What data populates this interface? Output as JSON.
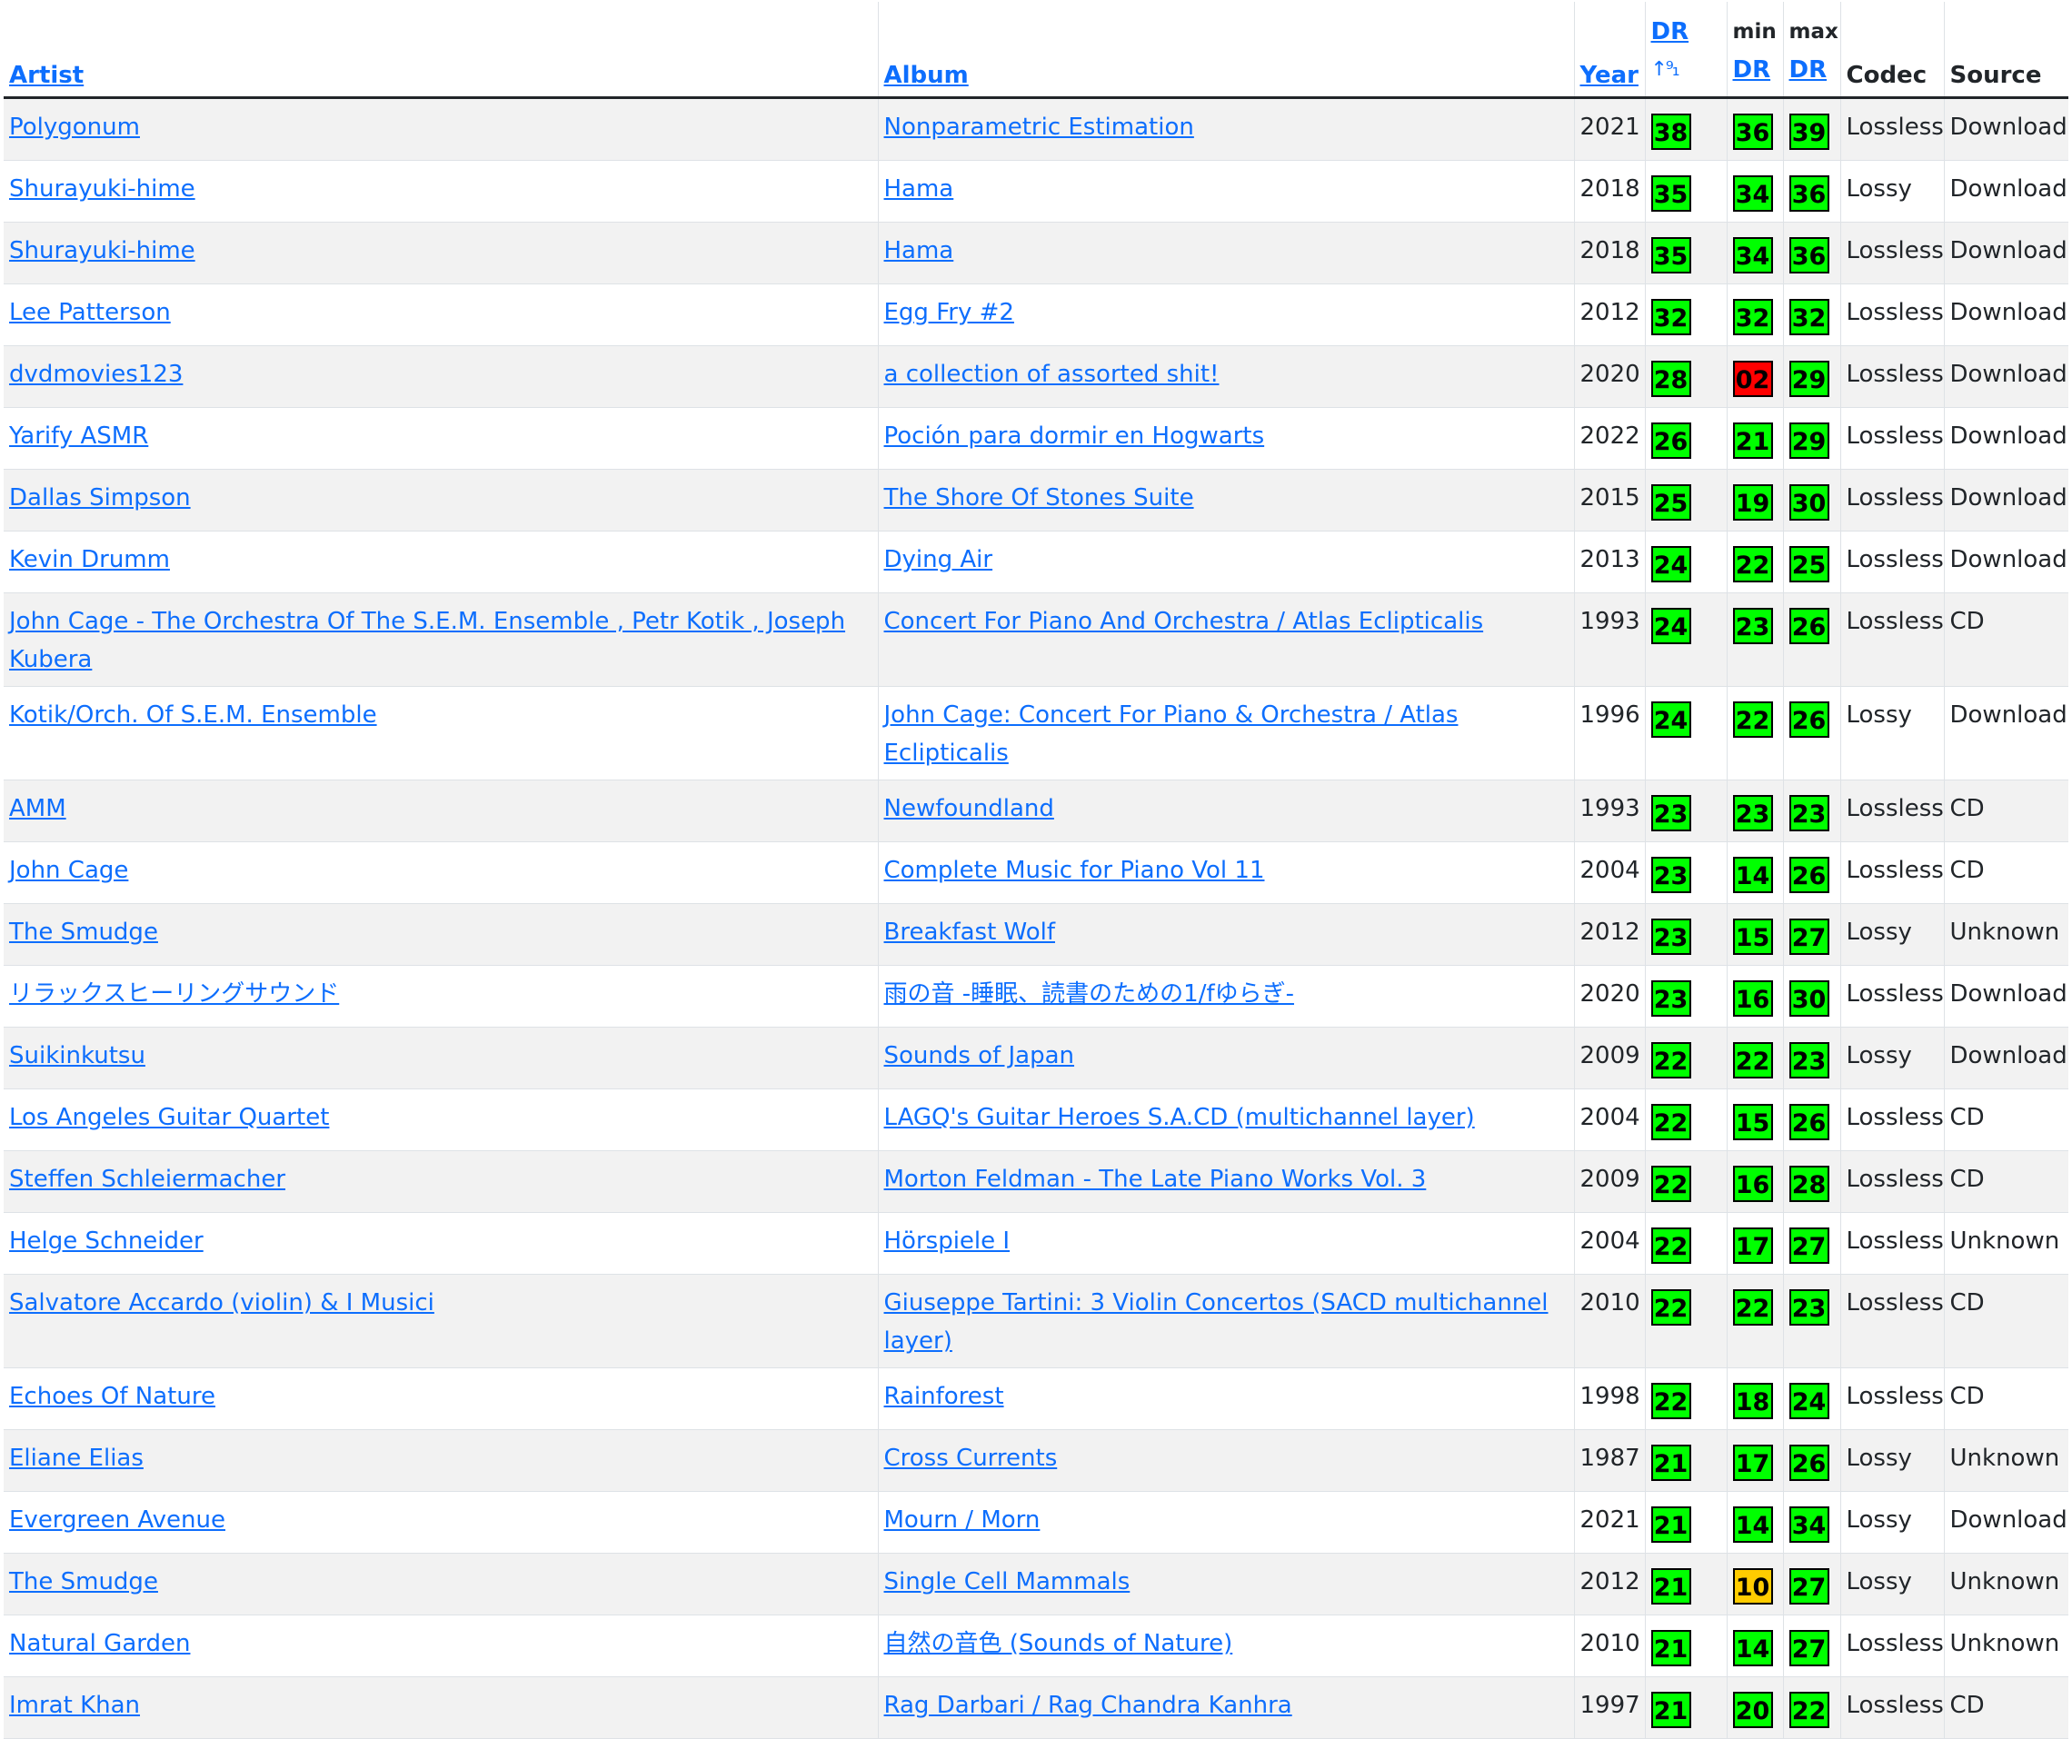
{
  "headers": {
    "artist": "Artist",
    "album": "Album",
    "year": "Year",
    "dr": "DR",
    "dr_sort_icon": "↑⁹₁",
    "min_label": "min",
    "min_dr": "DR",
    "max_label": "max",
    "max_dr": "DR",
    "codec": "Codec",
    "source": "Source"
  },
  "colors": {
    "link": "#0d6efd",
    "dr_good": "#00ff00",
    "dr_warn": "#ffcc00",
    "dr_bad": "#ff0000"
  },
  "rows": [
    {
      "artist": "Polygonum",
      "album": "Nonparametric Estimation",
      "year": "2021",
      "dr": "38",
      "min": "36",
      "max": "39",
      "codec": "Lossless",
      "source": "Download",
      "min_color": "green"
    },
    {
      "artist": "Shurayuki-hime",
      "album": "Hama",
      "year": "2018",
      "dr": "35",
      "min": "34",
      "max": "36",
      "codec": "Lossy",
      "source": "Download",
      "min_color": "green"
    },
    {
      "artist": "Shurayuki-hime",
      "album": "Hama",
      "year": "2018",
      "dr": "35",
      "min": "34",
      "max": "36",
      "codec": "Lossless",
      "source": "Download",
      "min_color": "green"
    },
    {
      "artist": "Lee Patterson",
      "album": "Egg Fry #2",
      "year": "2012",
      "dr": "32",
      "min": "32",
      "max": "32",
      "codec": "Lossless",
      "source": "Download",
      "min_color": "green"
    },
    {
      "artist": "dvdmovies123",
      "album": "a collection of assorted shit!",
      "year": "2020",
      "dr": "28",
      "min": "02",
      "max": "29",
      "codec": "Lossless",
      "source": "Download",
      "min_color": "red"
    },
    {
      "artist": "Yarify ASMR",
      "album": "Poción para dormir en Hogwarts",
      "year": "2022",
      "dr": "26",
      "min": "21",
      "max": "29",
      "codec": "Lossless",
      "source": "Download",
      "min_color": "green"
    },
    {
      "artist": "Dallas Simpson",
      "album": "The Shore Of Stones Suite",
      "year": "2015",
      "dr": "25",
      "min": "19",
      "max": "30",
      "codec": "Lossless",
      "source": "Download",
      "min_color": "green"
    },
    {
      "artist": "Kevin Drumm",
      "album": "Dying Air",
      "year": "2013",
      "dr": "24",
      "min": "22",
      "max": "25",
      "codec": "Lossless",
      "source": "Download",
      "min_color": "green"
    },
    {
      "artist": "John Cage - The Orchestra Of The S.E.M. Ensemble , Petr Kotik , Joseph Kubera",
      "album": "Concert For Piano And Orchestra / Atlas Eclipticalis",
      "year": "1993",
      "dr": "24",
      "min": "23",
      "max": "26",
      "codec": "Lossless",
      "source": "CD",
      "min_color": "green"
    },
    {
      "artist": "Kotik/Orch. Of S.E.M. Ensemble",
      "album": "John Cage: Concert For Piano & Orchestra / Atlas Eclipticalis",
      "year": "1996",
      "dr": "24",
      "min": "22",
      "max": "26",
      "codec": "Lossy",
      "source": "Download",
      "min_color": "green"
    },
    {
      "artist": "AMM",
      "album": "Newfoundland",
      "year": "1993",
      "dr": "23",
      "min": "23",
      "max": "23",
      "codec": "Lossless",
      "source": "CD",
      "min_color": "green"
    },
    {
      "artist": "John Cage",
      "album": "Complete Music for Piano Vol 11",
      "year": "2004",
      "dr": "23",
      "min": "14",
      "max": "26",
      "codec": "Lossless",
      "source": "CD",
      "min_color": "green"
    },
    {
      "artist": "The Smudge",
      "album": "Breakfast Wolf",
      "year": "2012",
      "dr": "23",
      "min": "15",
      "max": "27",
      "codec": "Lossy",
      "source": "Unknown",
      "min_color": "green"
    },
    {
      "artist": "リラックスヒーリングサウンド",
      "album": "雨の音 -睡眠、読書のための1/fゆらぎ-",
      "year": "2020",
      "dr": "23",
      "min": "16",
      "max": "30",
      "codec": "Lossless",
      "source": "Download",
      "min_color": "green"
    },
    {
      "artist": "Suikinkutsu",
      "album": "Sounds of Japan",
      "year": "2009",
      "dr": "22",
      "min": "22",
      "max": "23",
      "codec": "Lossy",
      "source": "Download",
      "min_color": "green"
    },
    {
      "artist": "Los Angeles Guitar Quartet",
      "album": "LAGQ's Guitar Heroes S.A.CD (multichannel layer)",
      "year": "2004",
      "dr": "22",
      "min": "15",
      "max": "26",
      "codec": "Lossless",
      "source": "CD",
      "min_color": "green"
    },
    {
      "artist": "Steffen Schleiermacher",
      "album": "Morton Feldman - The Late Piano Works Vol. 3",
      "year": "2009",
      "dr": "22",
      "min": "16",
      "max": "28",
      "codec": "Lossless",
      "source": "CD",
      "min_color": "green"
    },
    {
      "artist": "Helge Schneider",
      "album": "Hörspiele I",
      "year": "2004",
      "dr": "22",
      "min": "17",
      "max": "27",
      "codec": "Lossless",
      "source": "Unknown",
      "min_color": "green"
    },
    {
      "artist": "Salvatore Accardo (violin) & I Musici",
      "album": "Giuseppe Tartini: 3 Violin Concertos (SACD multichannel layer)",
      "year": "2010",
      "dr": "22",
      "min": "22",
      "max": "23",
      "codec": "Lossless",
      "source": "CD",
      "min_color": "green"
    },
    {
      "artist": "Echoes Of Nature",
      "album": "Rainforest",
      "year": "1998",
      "dr": "22",
      "min": "18",
      "max": "24",
      "codec": "Lossless",
      "source": "CD",
      "min_color": "green"
    },
    {
      "artist": "Eliane Elias",
      "album": "Cross Currents",
      "year": "1987",
      "dr": "21",
      "min": "17",
      "max": "26",
      "codec": "Lossy",
      "source": "Unknown",
      "min_color": "green"
    },
    {
      "artist": "Evergreen Avenue",
      "album": "Mourn / Morn",
      "year": "2021",
      "dr": "21",
      "min": "14",
      "max": "34",
      "codec": "Lossy",
      "source": "Download",
      "min_color": "green"
    },
    {
      "artist": "The Smudge",
      "album": "Single Cell Mammals",
      "year": "2012",
      "dr": "21",
      "min": "10",
      "max": "27",
      "codec": "Lossy",
      "source": "Unknown",
      "min_color": "yellow"
    },
    {
      "artist": "Natural Garden",
      "album": "自然の音色 (Sounds of Nature)",
      "year": "2010",
      "dr": "21",
      "min": "14",
      "max": "27",
      "codec": "Lossless",
      "source": "Unknown",
      "min_color": "green"
    },
    {
      "artist": "Imrat Khan",
      "album": "Rag Darbari / Rag Chandra Kanhra",
      "year": "1997",
      "dr": "21",
      "min": "20",
      "max": "22",
      "codec": "Lossless",
      "source": "CD",
      "min_color": "green"
    }
  ]
}
